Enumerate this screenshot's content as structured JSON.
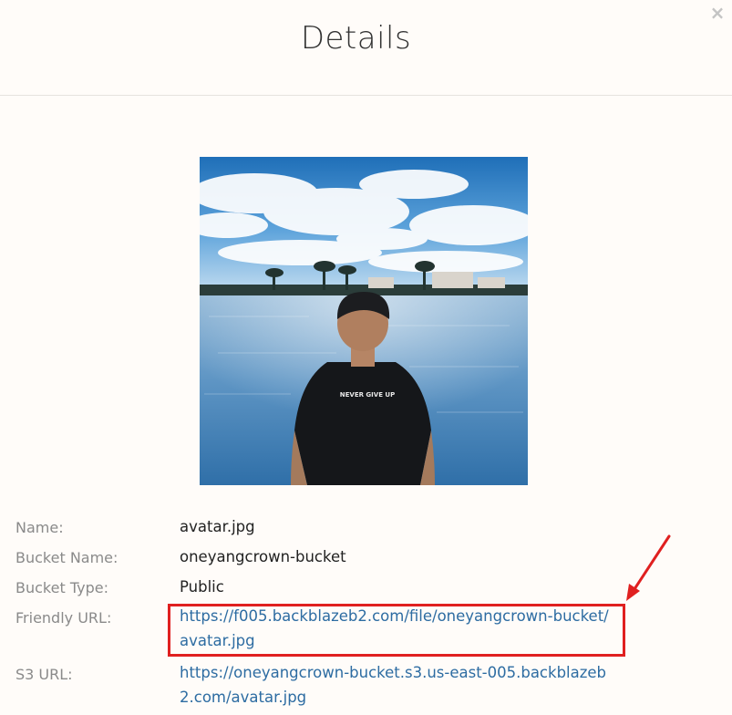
{
  "dialog": {
    "title": "Details",
    "close_symbol": "×"
  },
  "image": {
    "shirt_text": "NEVER GIVE UP"
  },
  "details": {
    "name_label": "Name:",
    "name_value": "avatar.jpg",
    "bucket_name_label": "Bucket Name:",
    "bucket_name_value": "oneyangcrown-bucket",
    "bucket_type_label": "Bucket Type:",
    "bucket_type_value": "Public",
    "friendly_url_label": "Friendly URL:",
    "friendly_url_line1": "https://f005.backblazeb2.com/file/oneyangcrown-bucket/",
    "friendly_url_line2": "avatar.jpg",
    "s3_url_label": "S3 URL:",
    "s3_url_line1": "https://oneyangcrown-bucket.s3.us-east-005.backblazeb",
    "s3_url_line2": "2.com/avatar.jpg"
  },
  "annotation": {
    "color": "#e02020"
  },
  "icons": {
    "close": "close-icon",
    "arrow": "arrow-icon"
  }
}
